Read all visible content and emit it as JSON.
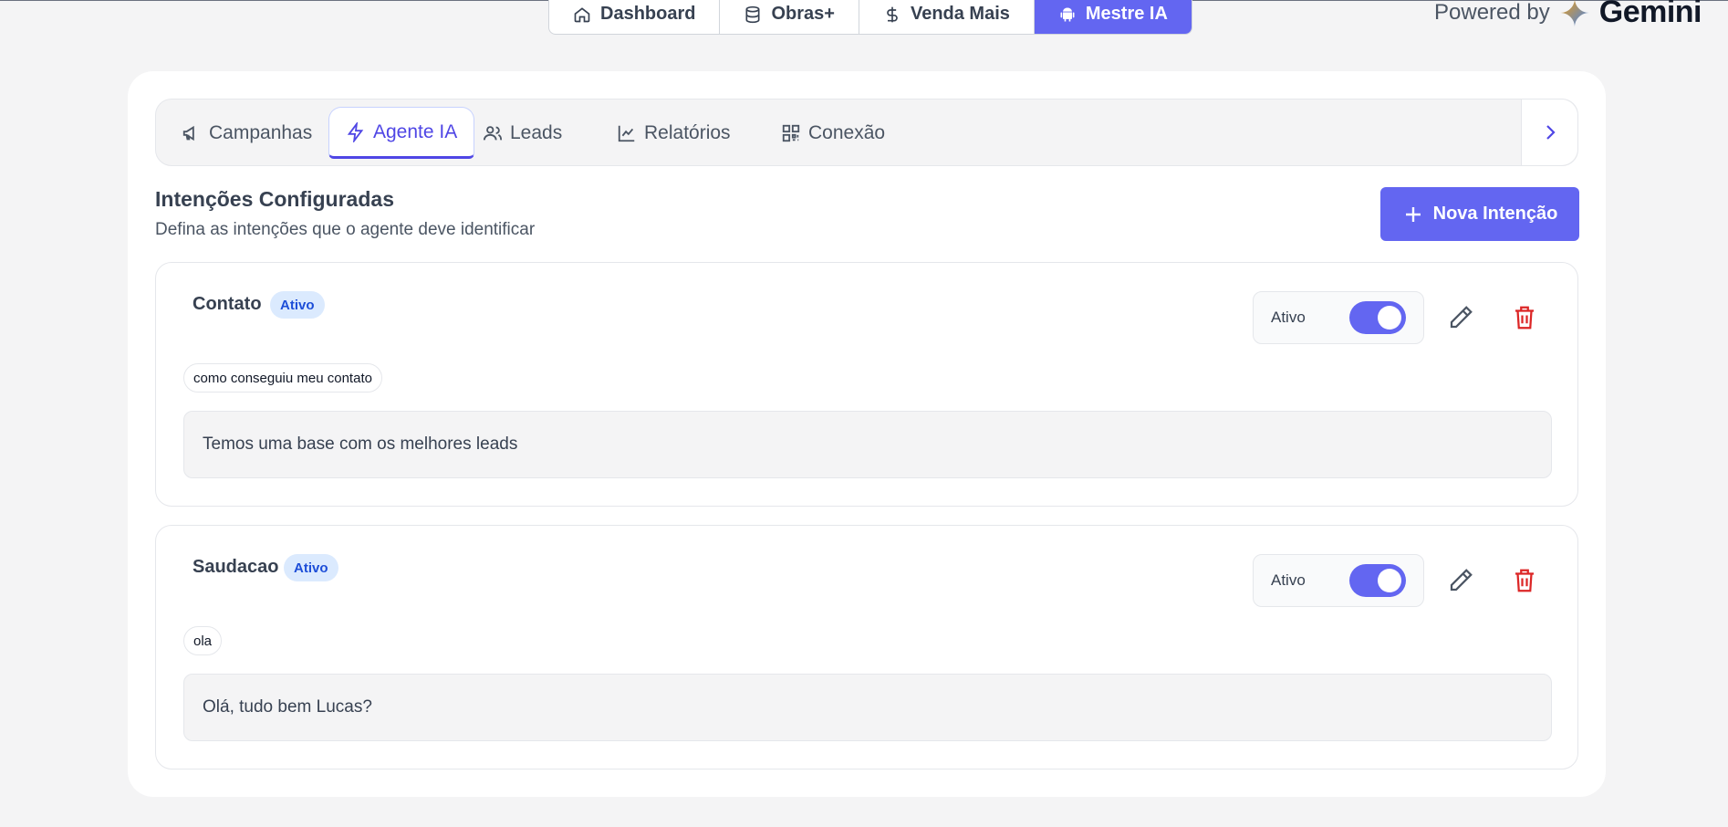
{
  "top_nav": {
    "items": [
      {
        "label": "Dashboard",
        "icon": "home-icon",
        "active": false
      },
      {
        "label": "Obras+",
        "icon": "database-icon",
        "active": false
      },
      {
        "label": "Venda Mais",
        "icon": "dollar-icon",
        "active": false
      },
      {
        "label": "Mestre IA",
        "icon": "android-icon",
        "active": true
      }
    ]
  },
  "powered_by": {
    "prefix": "Powered by",
    "brand": "Gemini"
  },
  "tabs": {
    "items": [
      {
        "label": "Campanhas",
        "icon": "megaphone-icon"
      },
      {
        "label": "Agente IA",
        "icon": "lightning-icon"
      },
      {
        "label": "Leads",
        "icon": "users-icon"
      },
      {
        "label": "Relatórios",
        "icon": "chart-line-icon"
      },
      {
        "label": "Conexão",
        "icon": "qr-code-icon"
      }
    ],
    "active_index": 1
  },
  "section": {
    "title": "Intenções Configuradas",
    "subtitle": "Defina as intenções que o agente deve identificar",
    "new_button_label": "Nova Intenção"
  },
  "intents": [
    {
      "name": "Contato",
      "badge": "Ativo",
      "toggle_label": "Ativo",
      "enabled": true,
      "keyword": "como conseguiu meu contato",
      "response": "Temos uma base com os melhores leads"
    },
    {
      "name": "Saudacao",
      "badge": "Ativo",
      "toggle_label": "Ativo",
      "enabled": true,
      "keyword": "ola",
      "response": "Olá, tudo bem Lucas?"
    }
  ],
  "colors": {
    "accent": "#6366f1",
    "danger": "#dc2626",
    "badge_bg": "#dbeafe",
    "badge_text": "#1d4ed8"
  }
}
